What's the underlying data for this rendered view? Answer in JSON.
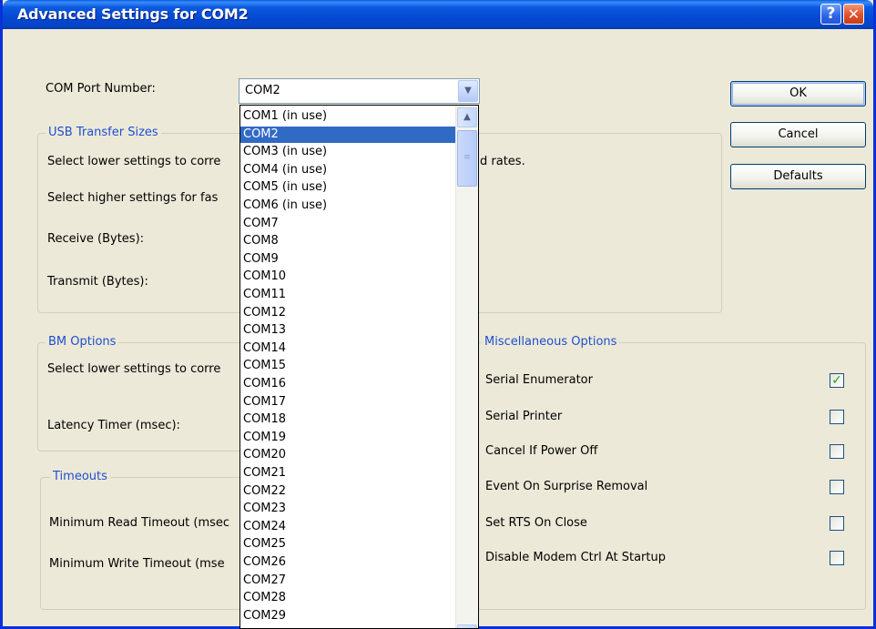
{
  "window": {
    "title": "Advanced Settings for COM2",
    "help_glyph": "?",
    "close_glyph": "✕"
  },
  "port": {
    "label": "COM Port Number:",
    "value": "COM2",
    "options": [
      "COM1 (in use)",
      "COM2",
      "COM3 (in use)",
      "COM4 (in use)",
      "COM5 (in use)",
      "COM6 (in use)",
      "COM7",
      "COM8",
      "COM9",
      "COM10",
      "COM11",
      "COM12",
      "COM13",
      "COM14",
      "COM15",
      "COM16",
      "COM17",
      "COM18",
      "COM19",
      "COM20",
      "COM21",
      "COM22",
      "COM23",
      "COM24",
      "COM25",
      "COM26",
      "COM27",
      "COM28",
      "COM29"
    ],
    "selected_index": 1
  },
  "buttons": {
    "ok": "OK",
    "cancel": "Cancel",
    "defaults": "Defaults"
  },
  "usb": {
    "title": "USB Transfer Sizes",
    "line1_left": "Select lower settings to corre",
    "line1_right": "d rates.",
    "line2": "Select higher settings for fas",
    "receive": "Receive (Bytes):",
    "transmit": "Transmit (Bytes):"
  },
  "bm": {
    "title": "BM Options",
    "line1": "Select lower settings to corre",
    "latency": "Latency Timer (msec):"
  },
  "timeouts": {
    "title": "Timeouts",
    "read": "Minimum Read Timeout (msec",
    "write": "Minimum Write Timeout (mse"
  },
  "misc": {
    "title": "Miscellaneous Options",
    "options": [
      {
        "label": "Serial Enumerator",
        "checked": true
      },
      {
        "label": "Serial Printer",
        "checked": false
      },
      {
        "label": "Cancel If Power Off",
        "checked": false
      },
      {
        "label": "Event On Surprise Removal",
        "checked": false
      },
      {
        "label": "Set RTS On Close",
        "checked": false
      },
      {
        "label": "Disable Modem Ctrl At Startup",
        "checked": false
      }
    ]
  },
  "icons": {
    "dropdown_arrow": "chevron-down-icon",
    "scroll_up": "chevron-up-icon",
    "check": "checkmark-icon"
  },
  "colors": {
    "titlebar": "#0449d4",
    "selection": "#316ac5",
    "group_title": "#1f4fcf",
    "check": "#21a121"
  }
}
